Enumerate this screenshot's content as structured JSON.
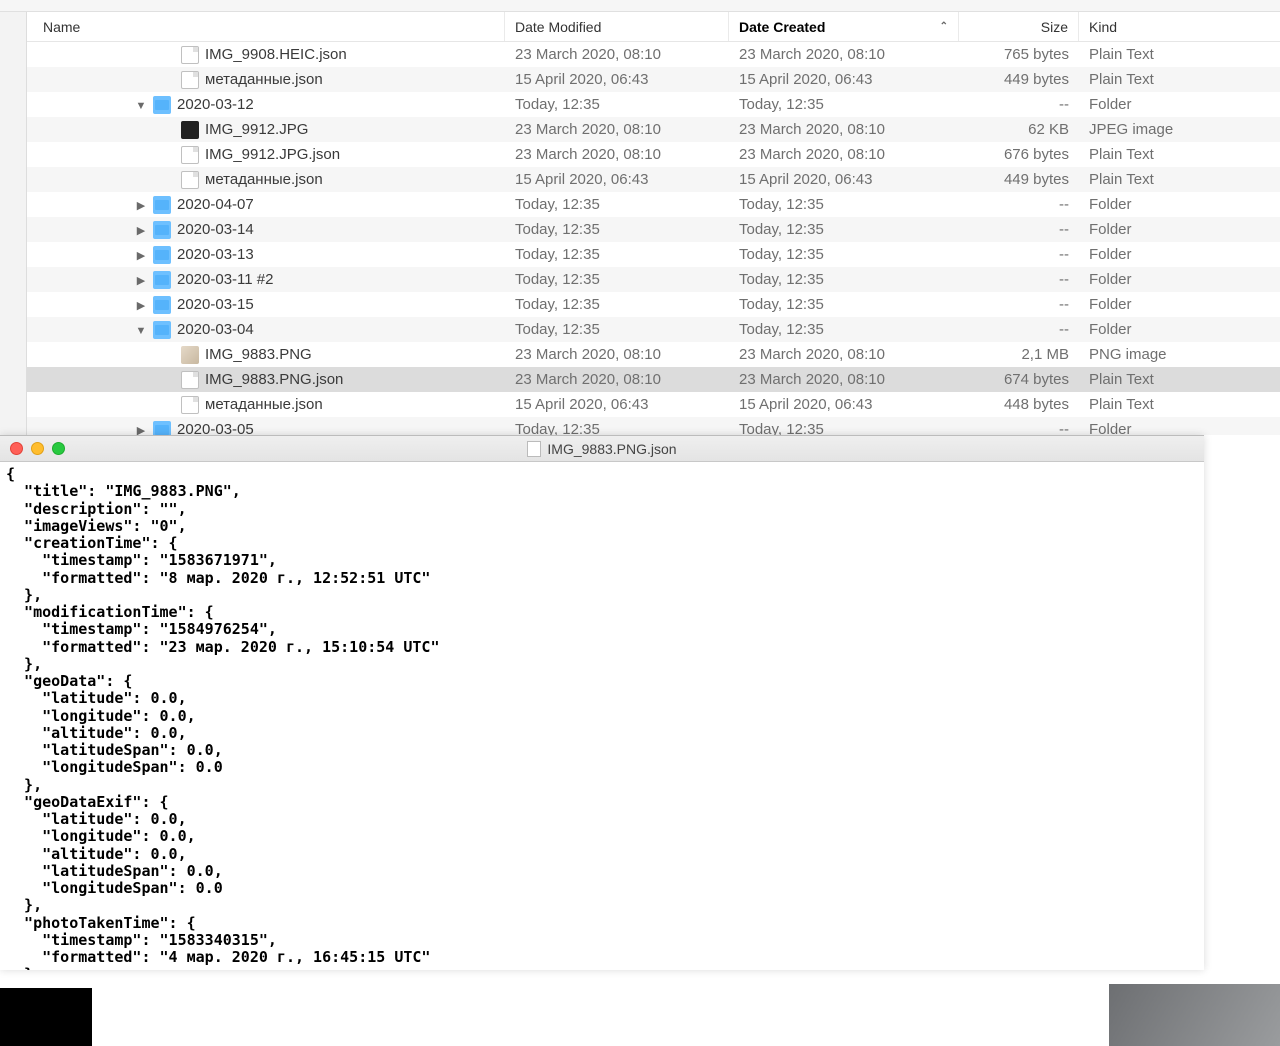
{
  "columns": {
    "name": "Name",
    "date_modified": "Date Modified",
    "date_created": "Date Created",
    "size": "Size",
    "kind": "Kind"
  },
  "rows": [
    {
      "indent": 3,
      "icon": "doc",
      "disclosure": "",
      "name": "IMG_9908.HEIC.json",
      "mod": "23 March 2020, 08:10",
      "created": "23 March 2020, 08:10",
      "size": "765 bytes",
      "kind": "Plain Text",
      "alt": false
    },
    {
      "indent": 3,
      "icon": "doc",
      "disclosure": "",
      "name": "метаданные.json",
      "mod": "15 April 2020, 06:43",
      "created": "15 April 2020, 06:43",
      "size": "449 bytes",
      "kind": "Plain Text",
      "alt": true
    },
    {
      "indent": 2,
      "icon": "folder",
      "disclosure": "down",
      "name": "2020-03-12",
      "mod": "Today, 12:35",
      "created": "Today, 12:35",
      "size": "--",
      "kind": "Folder",
      "alt": false
    },
    {
      "indent": 3,
      "icon": "jpg",
      "disclosure": "",
      "name": "IMG_9912.JPG",
      "mod": "23 March 2020, 08:10",
      "created": "23 March 2020, 08:10",
      "size": "62 KB",
      "kind": "JPEG image",
      "alt": true
    },
    {
      "indent": 3,
      "icon": "doc",
      "disclosure": "",
      "name": "IMG_9912.JPG.json",
      "mod": "23 March 2020, 08:10",
      "created": "23 March 2020, 08:10",
      "size": "676 bytes",
      "kind": "Plain Text",
      "alt": false
    },
    {
      "indent": 3,
      "icon": "doc",
      "disclosure": "",
      "name": "метаданные.json",
      "mod": "15 April 2020, 06:43",
      "created": "15 April 2020, 06:43",
      "size": "449 bytes",
      "kind": "Plain Text",
      "alt": true
    },
    {
      "indent": 2,
      "icon": "folder",
      "disclosure": "right",
      "name": "2020-04-07",
      "mod": "Today, 12:35",
      "created": "Today, 12:35",
      "size": "--",
      "kind": "Folder",
      "alt": false
    },
    {
      "indent": 2,
      "icon": "folder",
      "disclosure": "right",
      "name": "2020-03-14",
      "mod": "Today, 12:35",
      "created": "Today, 12:35",
      "size": "--",
      "kind": "Folder",
      "alt": true
    },
    {
      "indent": 2,
      "icon": "folder",
      "disclosure": "right",
      "name": "2020-03-13",
      "mod": "Today, 12:35",
      "created": "Today, 12:35",
      "size": "--",
      "kind": "Folder",
      "alt": false
    },
    {
      "indent": 2,
      "icon": "folder",
      "disclosure": "right",
      "name": "2020-03-11 #2",
      "mod": "Today, 12:35",
      "created": "Today, 12:35",
      "size": "--",
      "kind": "Folder",
      "alt": true
    },
    {
      "indent": 2,
      "icon": "folder",
      "disclosure": "right",
      "name": "2020-03-15",
      "mod": "Today, 12:35",
      "created": "Today, 12:35",
      "size": "--",
      "kind": "Folder",
      "alt": false
    },
    {
      "indent": 2,
      "icon": "folder",
      "disclosure": "down",
      "name": "2020-03-04",
      "mod": "Today, 12:35",
      "created": "Today, 12:35",
      "size": "--",
      "kind": "Folder",
      "alt": true
    },
    {
      "indent": 3,
      "icon": "png",
      "disclosure": "",
      "name": "IMG_9883.PNG",
      "mod": "23 March 2020, 08:10",
      "created": "23 March 2020, 08:10",
      "size": "2,1 MB",
      "kind": "PNG image",
      "alt": false
    },
    {
      "indent": 3,
      "icon": "doc",
      "disclosure": "",
      "name": "IMG_9883.PNG.json",
      "mod": "23 March 2020, 08:10",
      "created": "23 March 2020, 08:10",
      "size": "674 bytes",
      "kind": "Plain Text",
      "alt": true,
      "selected": true
    },
    {
      "indent": 3,
      "icon": "doc",
      "disclosure": "",
      "name": "метаданные.json",
      "mod": "15 April 2020, 06:43",
      "created": "15 April 2020, 06:43",
      "size": "448 bytes",
      "kind": "Plain Text",
      "alt": false
    },
    {
      "indent": 2,
      "icon": "folder",
      "disclosure": "right",
      "name": "2020-03-05",
      "mod": "Today, 12:35",
      "created": "Today, 12:35",
      "size": "--",
      "kind": "Folder",
      "alt": true
    }
  ],
  "viewer": {
    "title": "IMG_9883.PNG.json",
    "content": "{\n  \"title\": \"IMG_9883.PNG\",\n  \"description\": \"\",\n  \"imageViews\": \"0\",\n  \"creationTime\": {\n    \"timestamp\": \"1583671971\",\n    \"formatted\": \"8 мар. 2020 г., 12:52:51 UTC\"\n  },\n  \"modificationTime\": {\n    \"timestamp\": \"1584976254\",\n    \"formatted\": \"23 мар. 2020 г., 15:10:54 UTC\"\n  },\n  \"geoData\": {\n    \"latitude\": 0.0,\n    \"longitude\": 0.0,\n    \"altitude\": 0.0,\n    \"latitudeSpan\": 0.0,\n    \"longitudeSpan\": 0.0\n  },\n  \"geoDataExif\": {\n    \"latitude\": 0.0,\n    \"longitude\": 0.0,\n    \"altitude\": 0.0,\n    \"latitudeSpan\": 0.0,\n    \"longitudeSpan\": 0.0\n  },\n  \"photoTakenTime\": {\n    \"timestamp\": \"1583340315\",\n    \"formatted\": \"4 мар. 2020 г., 16:45:15 UTC\"\n  }"
  }
}
